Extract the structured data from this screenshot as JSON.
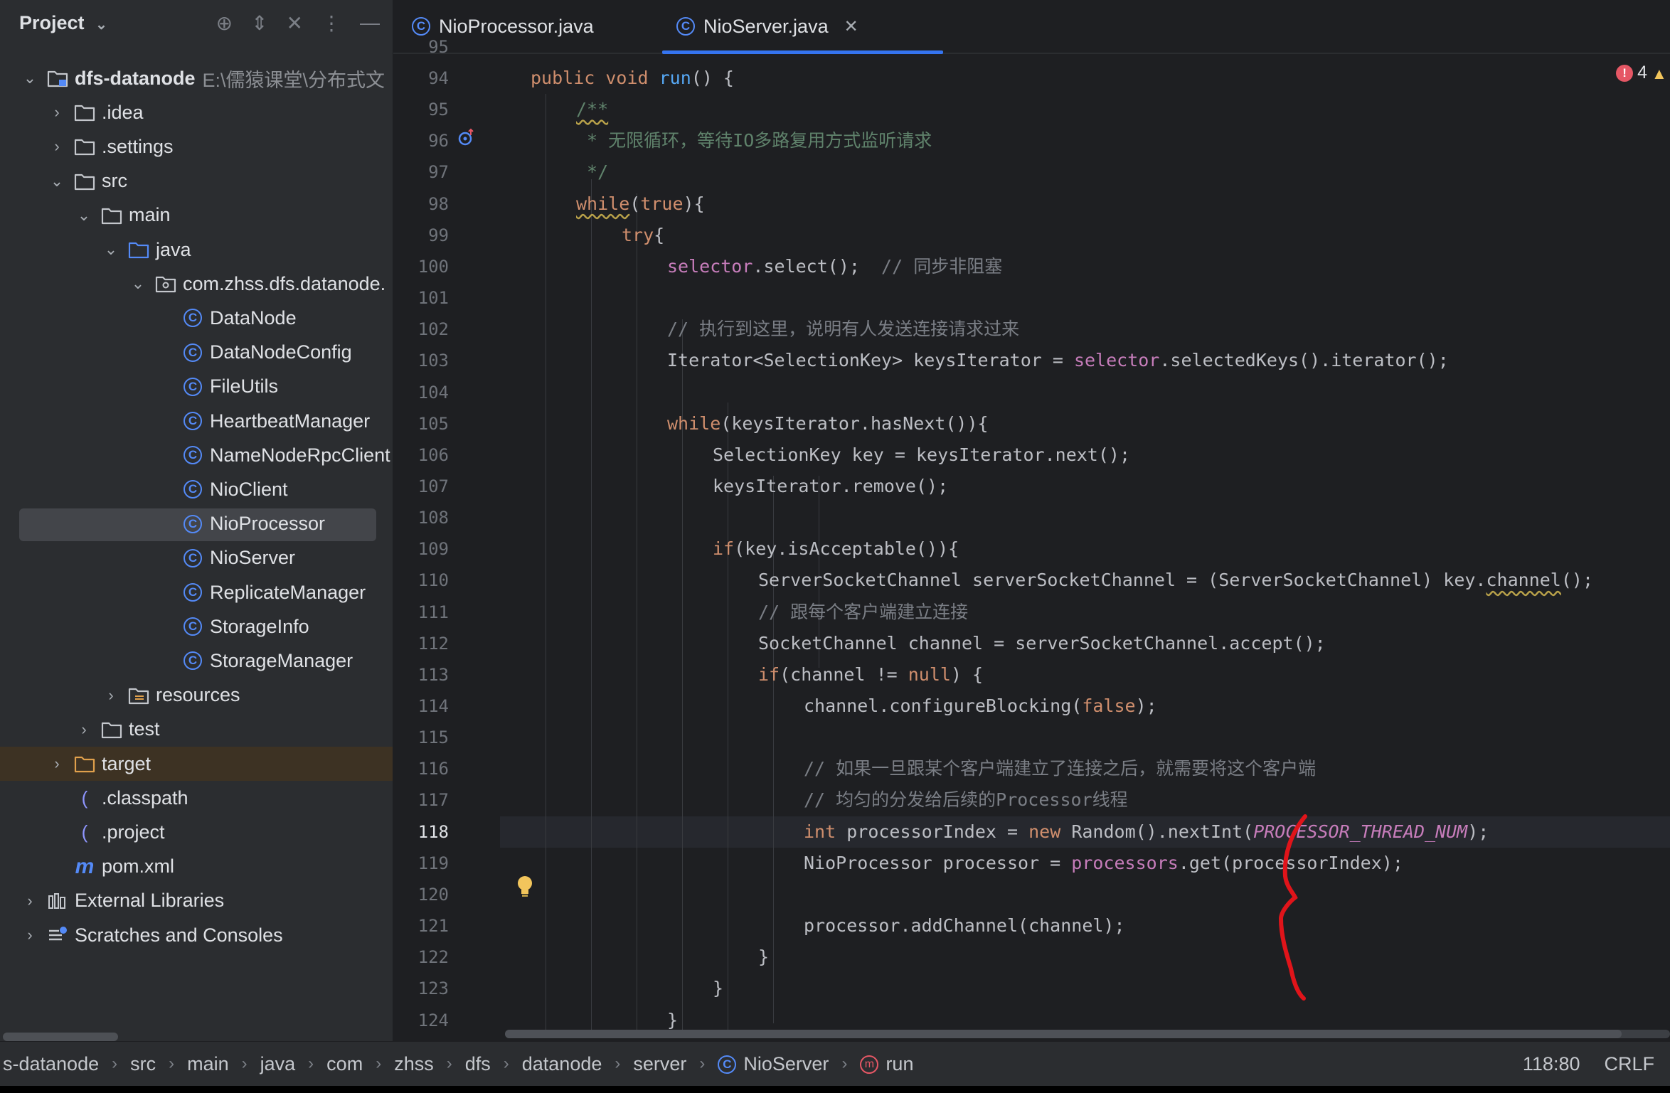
{
  "project_panel": {
    "title": "Project",
    "tree": [
      {
        "label": "dfs-datanode",
        "hint": "E:\\儒猿课堂\\分布式文",
        "kind": "module",
        "level": 0,
        "expanded": true,
        "bold": true
      },
      {
        "label": ".idea",
        "kind": "folder",
        "level": 1,
        "expanded": false
      },
      {
        "label": ".settings",
        "kind": "folder",
        "level": 1,
        "expanded": false
      },
      {
        "label": "src",
        "kind": "folder",
        "level": 1,
        "expanded": true
      },
      {
        "label": "main",
        "kind": "folder",
        "level": 2,
        "expanded": true
      },
      {
        "label": "java",
        "kind": "source-folder",
        "level": 3,
        "expanded": true
      },
      {
        "label": "com.zhss.dfs.datanode.",
        "kind": "package",
        "level": 4,
        "expanded": true
      },
      {
        "label": "DataNode",
        "kind": "class",
        "level": 5
      },
      {
        "label": "DataNodeConfig",
        "kind": "class",
        "level": 5
      },
      {
        "label": "FileUtils",
        "kind": "class",
        "level": 5
      },
      {
        "label": "HeartbeatManager",
        "kind": "class",
        "level": 5
      },
      {
        "label": "NameNodeRpcClient",
        "kind": "class",
        "level": 5
      },
      {
        "label": "NioClient",
        "kind": "class",
        "level": 5
      },
      {
        "label": "NioProcessor",
        "kind": "class",
        "level": 5,
        "selected": true
      },
      {
        "label": "NioServer",
        "kind": "class",
        "level": 5
      },
      {
        "label": "ReplicateManager",
        "kind": "class",
        "level": 5
      },
      {
        "label": "StorageInfo",
        "kind": "class",
        "level": 5
      },
      {
        "label": "StorageManager",
        "kind": "class",
        "level": 5
      },
      {
        "label": "resources",
        "kind": "resources-folder",
        "level": 3,
        "expanded": false
      },
      {
        "label": "test",
        "kind": "folder",
        "level": 2,
        "expanded": false
      },
      {
        "label": "target",
        "kind": "excluded-folder",
        "level": 1,
        "expanded": false,
        "highlight": true
      },
      {
        "label": ".classpath",
        "kind": "file",
        "level": 1
      },
      {
        "label": ".project",
        "kind": "file",
        "level": 1
      },
      {
        "label": "pom.xml",
        "kind": "maven",
        "level": 1
      },
      {
        "label": "External Libraries",
        "kind": "libraries",
        "level": 0,
        "expanded": false
      },
      {
        "label": "Scratches and Consoles",
        "kind": "scratches",
        "level": 0,
        "expanded": false
      }
    ]
  },
  "tabs": [
    {
      "label": "NioProcessor.java",
      "active": false
    },
    {
      "label": "NioServer.java",
      "active": true,
      "close": "✕"
    }
  ],
  "editor": {
    "problems_count": "4",
    "top_partial_line": "95",
    "current_line": 118,
    "lines": [
      {
        "n": "94",
        "indent": 1,
        "t": [
          [
            "kw",
            "public "
          ],
          [
            "kw",
            "void "
          ],
          [
            "fn",
            "run"
          ],
          [
            "",
            "() {"
          ]
        ]
      },
      {
        "n": "95",
        "indent": 2,
        "t": [
          [
            "doc warn",
            "/**"
          ]
        ]
      },
      {
        "n": "96",
        "indent": 2,
        "t": [
          [
            "doc",
            " * 无限循环，等待IO多路复用方式监听请求"
          ]
        ]
      },
      {
        "n": "97",
        "indent": 2,
        "t": [
          [
            "doc",
            " */"
          ]
        ]
      },
      {
        "n": "98",
        "indent": 2,
        "t": [
          [
            "kw warn",
            "while"
          ],
          [
            "",
            "("
          ],
          [
            "kw",
            "true"
          ],
          [
            "",
            "){"
          ]
        ]
      },
      {
        "n": "99",
        "indent": 3,
        "t": [
          [
            "kw",
            "try"
          ],
          [
            "",
            "{"
          ]
        ]
      },
      {
        "n": "100",
        "indent": 4,
        "t": [
          [
            "fld",
            "selector"
          ],
          [
            "",
            ".select();  "
          ],
          [
            "cmt",
            "// 同步非阻塞"
          ]
        ]
      },
      {
        "n": "101",
        "indent": 4,
        "t": []
      },
      {
        "n": "102",
        "indent": 4,
        "t": [
          [
            "cmt",
            "// 执行到这里，说明有人发送连接请求过来"
          ]
        ]
      },
      {
        "n": "103",
        "indent": 4,
        "t": [
          [
            "",
            "Iterator<SelectionKey> keysIterator = "
          ],
          [
            "fld",
            "selector"
          ],
          [
            "",
            ".selectedKeys().iterator();"
          ]
        ]
      },
      {
        "n": "104",
        "indent": 4,
        "t": []
      },
      {
        "n": "105",
        "indent": 4,
        "t": [
          [
            "kw",
            "while"
          ],
          [
            "",
            "(keysIterator.hasNext()){"
          ]
        ]
      },
      {
        "n": "106",
        "indent": 5,
        "t": [
          [
            "",
            "SelectionKey key = keysIterator.next();"
          ]
        ]
      },
      {
        "n": "107",
        "indent": 5,
        "t": [
          [
            "",
            "keysIterator.remove();"
          ]
        ]
      },
      {
        "n": "108",
        "indent": 5,
        "t": []
      },
      {
        "n": "109",
        "indent": 5,
        "t": [
          [
            "kw",
            "if"
          ],
          [
            "",
            "(key.isAcceptable()){"
          ]
        ]
      },
      {
        "n": "110",
        "indent": 6,
        "t": [
          [
            "",
            "ServerSocketChannel serverSocketChannel = (ServerSocketChannel) key."
          ],
          [
            "warn",
            "channel"
          ],
          [
            "",
            "();"
          ]
        ]
      },
      {
        "n": "111",
        "indent": 6,
        "t": [
          [
            "cmt",
            "// 跟每个客户端建立连接"
          ]
        ]
      },
      {
        "n": "112",
        "indent": 6,
        "t": [
          [
            "",
            "SocketChannel channel = serverSocketChannel.accept();"
          ]
        ]
      },
      {
        "n": "113",
        "indent": 6,
        "t": [
          [
            "kw",
            "if"
          ],
          [
            "",
            "(channel != "
          ],
          [
            "kw",
            "null"
          ],
          [
            "",
            ") {"
          ]
        ]
      },
      {
        "n": "114",
        "indent": 7,
        "t": [
          [
            "",
            "channel.configureBlocking("
          ],
          [
            "kw",
            "false"
          ],
          [
            "",
            ");"
          ]
        ]
      },
      {
        "n": "115",
        "indent": 7,
        "t": []
      },
      {
        "n": "116",
        "indent": 7,
        "t": [
          [
            "cmt",
            "// 如果一旦跟某个客户端建立了连接之后，就需要将这个客户端"
          ]
        ]
      },
      {
        "n": "117",
        "indent": 7,
        "t": [
          [
            "cmt",
            "// 均匀的分发给后续的Processor线程"
          ]
        ]
      },
      {
        "n": "118",
        "indent": 7,
        "t": [
          [
            "kw",
            "int "
          ],
          [
            "",
            "processorIndex = "
          ],
          [
            "kw",
            "new "
          ],
          [
            "",
            "Random().nextInt("
          ],
          [
            "const",
            "PROCESSOR_THREAD_NUM"
          ],
          [
            "",
            ");"
          ]
        ]
      },
      {
        "n": "119",
        "indent": 7,
        "t": [
          [
            "",
            "NioProcessor processor = "
          ],
          [
            "fld",
            "processors"
          ],
          [
            "",
            ".get(processorIndex);"
          ]
        ]
      },
      {
        "n": "120",
        "indent": 7,
        "t": []
      },
      {
        "n": "121",
        "indent": 7,
        "t": [
          [
            "",
            "processor.addChannel(channel);"
          ]
        ]
      },
      {
        "n": "122",
        "indent": 6,
        "t": [
          [
            "",
            "}"
          ]
        ]
      },
      {
        "n": "123",
        "indent": 5,
        "t": [
          [
            "",
            "}"
          ]
        ]
      },
      {
        "n": "124",
        "indent": 4,
        "t": [
          [
            "",
            "}"
          ]
        ]
      }
    ]
  },
  "breadcrumbs": [
    "s-datanode",
    "src",
    "main",
    "java",
    "com",
    "zhss",
    "dfs",
    "datanode",
    "server",
    "NioServer",
    "run"
  ],
  "status": {
    "position": "118:80",
    "line_ending": "CRLF"
  },
  "colors": {
    "accent": "#3574f0",
    "keyword": "#cf8e6d",
    "function": "#56a8f5",
    "field": "#c77dbb",
    "comment": "#7a7e85",
    "doc_comment": "#5f826b",
    "annotation_red": "#e0141a",
    "error": "#e55765",
    "bulb": "#f2c55c"
  }
}
